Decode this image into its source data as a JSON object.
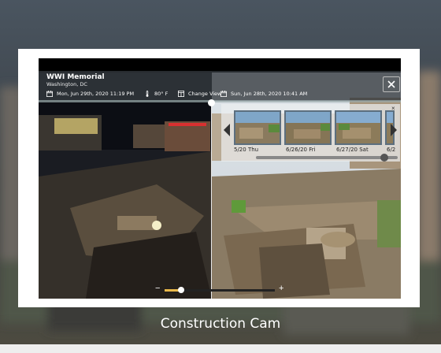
{
  "header": {
    "title": "WWI Memorial",
    "location": "Washington, DC",
    "left_datetime": "Mon, Jun 29th, 2020 11:19 PM",
    "temperature": "80° F",
    "change_view_label": "Change View",
    "right_datetime": "Sun, Jun 28th, 2020 10:41 AM"
  },
  "carousel": {
    "close_glyph": "×",
    "thumbnails": [
      {
        "label": "5/20 Thu"
      },
      {
        "label": "6/26/20 Fri"
      },
      {
        "label": "6/27/20 Sat"
      },
      {
        "label": "6/2"
      }
    ]
  },
  "zoom": {
    "minus": "−",
    "plus": "+",
    "level": 0.15
  },
  "compare_split": 0.48,
  "caption": "Construction Cam",
  "colors": {
    "accent_zoom": "#e9b84a",
    "thumb_border": "#5c6f7f",
    "card": "#ffffff"
  }
}
